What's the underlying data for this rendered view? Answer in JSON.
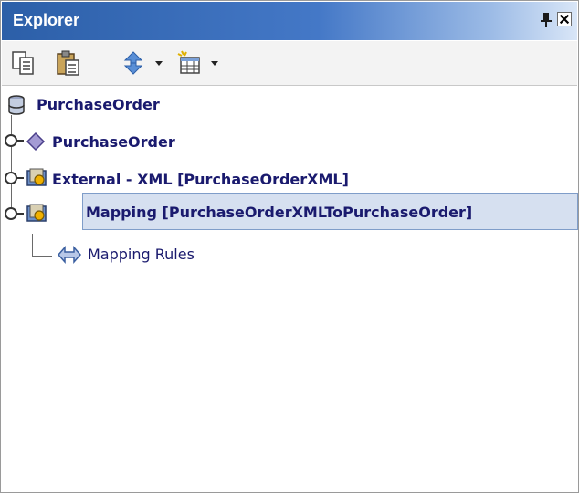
{
  "panel": {
    "title": "Explorer",
    "pin_icon": "pin-icon",
    "close_icon": "close-icon"
  },
  "toolbar": {
    "buttons": [
      "copy-icon",
      "paste-icon",
      "sync-icon",
      "new-table-icon"
    ]
  },
  "tree": {
    "root": "PurchaseOrder",
    "children": [
      {
        "label": "PurchaseOrder",
        "icon": "diamond-icon"
      },
      {
        "label": "External - XML [PurchaseOrderXML]",
        "icon": "folder-icon"
      },
      {
        "label": "Mapping [PurchaseOrderXMLToPurchaseOrder]",
        "icon": "folder-icon",
        "selected": true,
        "children": [
          {
            "label": "Mapping Rules",
            "icon": "mapping-rules-icon"
          }
        ]
      }
    ]
  }
}
